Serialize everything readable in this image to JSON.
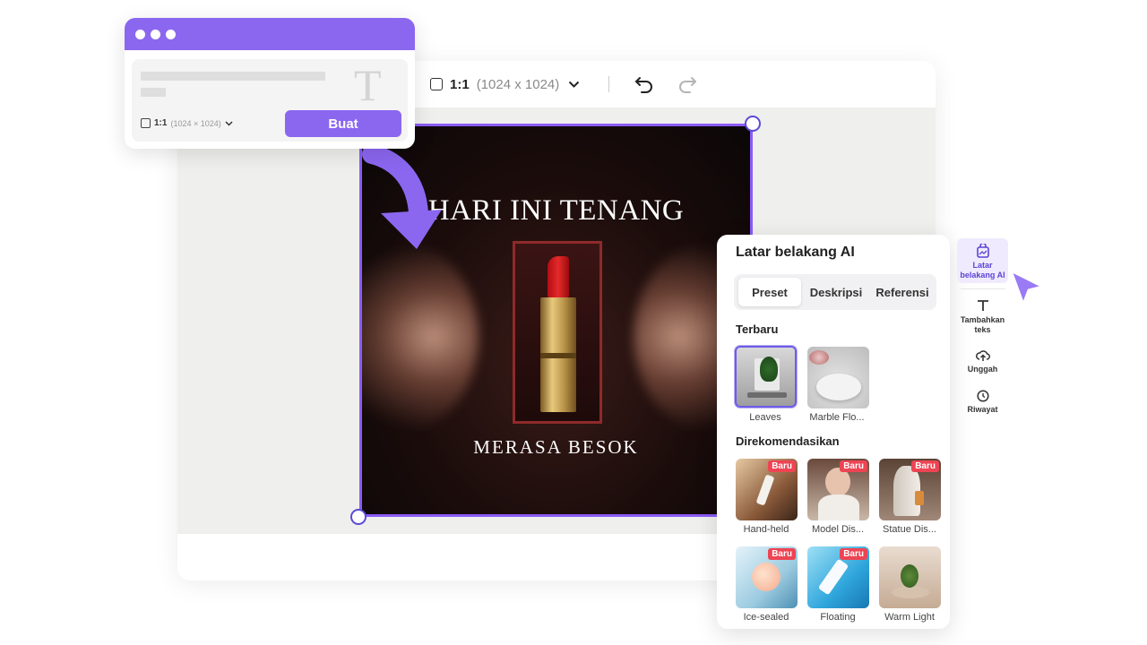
{
  "toolbar": {
    "ratio_label": "1:1",
    "ratio_dims": "(1024 x 1024)",
    "chevron_icon": "chevron-down-icon",
    "undo_icon": "undo-icon",
    "redo_icon": "redo-icon"
  },
  "design": {
    "title": "HARI INI TENANG",
    "subtitle": "MERASA BESOK"
  },
  "prompt_card": {
    "ratio_label": "1:1",
    "ratio_dims": "(1024 × 1024)",
    "button_label": "Buat",
    "placeholder_icon": "text-T-icon",
    "accent_color": "#8b67f0"
  },
  "panel": {
    "title": "Latar belakang AI",
    "tabs": [
      {
        "label": "Preset",
        "active": true
      },
      {
        "label": "Deskripsi",
        "active": false
      },
      {
        "label": "Referensi",
        "active": false
      }
    ],
    "recent_label": "Terbaru",
    "recent": [
      {
        "label": "Leaves",
        "selected": true
      },
      {
        "label": "Marble Flo...",
        "selected": false
      }
    ],
    "recommended_label": "Direkomendasikan",
    "badge_label": "Baru",
    "recommended": [
      {
        "label": "Hand-held",
        "badge": true
      },
      {
        "label": "Model Dis...",
        "badge": true
      },
      {
        "label": "Statue Dis...",
        "badge": true
      },
      {
        "label": "Ice-sealed",
        "badge": true
      },
      {
        "label": "Floating",
        "badge": true
      },
      {
        "label": "Warm Light",
        "badge": false
      }
    ]
  },
  "rail": {
    "items": [
      {
        "label": "Latar belakang AI",
        "icon": "ai-background-icon",
        "active": true
      },
      {
        "label": "Tambahkan teks",
        "icon": "text-icon",
        "active": false
      },
      {
        "label": "Unggah",
        "icon": "upload-cloud-icon",
        "active": false
      },
      {
        "label": "Riwayat",
        "icon": "history-clock-icon",
        "active": false
      }
    ]
  },
  "colors": {
    "accent": "#8b5cf6",
    "badge": "#ee4453"
  }
}
